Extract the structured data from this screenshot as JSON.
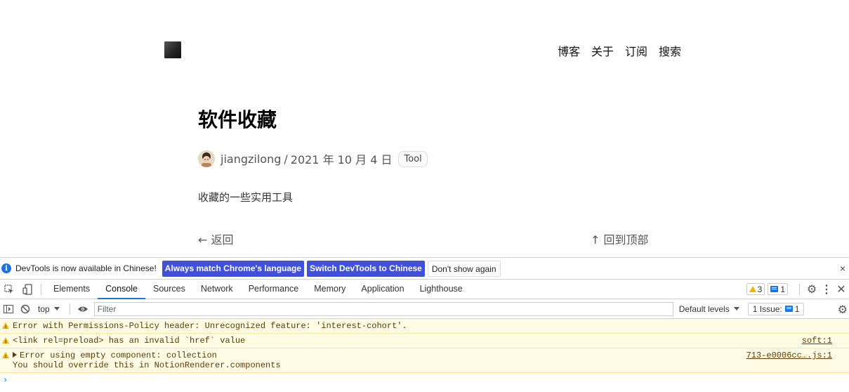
{
  "page": {
    "nav": [
      "博客",
      "关于",
      "订阅",
      "搜索"
    ],
    "title": "软件收藏",
    "author": "jiangzilong",
    "separator": "/",
    "date": "2021 年 10 月 4 日",
    "tag": "Tool",
    "description": "收藏的一些实用工具",
    "back_label": "← 返回",
    "top_label": "↑ 回到顶部"
  },
  "devtools": {
    "infobar": {
      "message": "DevTools is now available in Chinese!",
      "btn_match": "Always match Chrome's language",
      "btn_switch": "Switch DevTools to Chinese",
      "btn_dismiss": "Don't show again",
      "close": "×"
    },
    "tabs": [
      "Elements",
      "Console",
      "Sources",
      "Network",
      "Performance",
      "Memory",
      "Application",
      "Lighthouse"
    ],
    "active_tab": "Console",
    "warning_count": "3",
    "message_count": "1",
    "filterbar": {
      "context": "top",
      "filter_placeholder": "Filter",
      "levels": "Default levels",
      "issues_label": "1 Issue:",
      "issues_count": "1"
    },
    "logs": [
      {
        "text": "Error with Permissions-Policy header: Unrecognized feature: 'interest-cohort'.",
        "source": ""
      },
      {
        "text": "<link rel=preload> has an invalid `href` value",
        "source": "soft:1"
      },
      {
        "text": "Error using empty component: collection",
        "text2": "You should override this in NotionRenderer.components",
        "source": "713-e0006cc….js:1"
      }
    ],
    "prompt": "›",
    "colors": {
      "accent": "#1a73e8",
      "primary_button": "#3f51d9",
      "warning_bg": "#fffbe5",
      "warning_text": "#5c3c00"
    }
  }
}
